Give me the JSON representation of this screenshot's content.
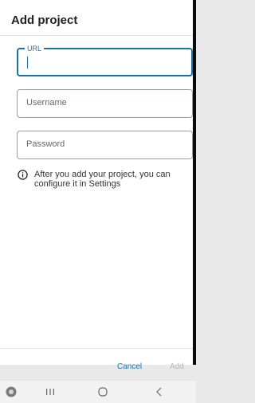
{
  "dialog": {
    "title": "Add project",
    "fields": {
      "url": {
        "label": "URL",
        "value": ""
      },
      "username": {
        "placeholder": "Username"
      },
      "password": {
        "placeholder": "Password"
      }
    },
    "info_text": "After you add your project, you can configure it in Settings",
    "buttons": {
      "cancel": "Cancel",
      "add": "Add"
    }
  },
  "navbar": {
    "icons": [
      "app-icon",
      "recents-icon",
      "home-icon",
      "back-icon"
    ]
  },
  "colors": {
    "accent": "#1a73a8",
    "disabled": "#b8b8b8",
    "border": "#9aa0a6"
  }
}
